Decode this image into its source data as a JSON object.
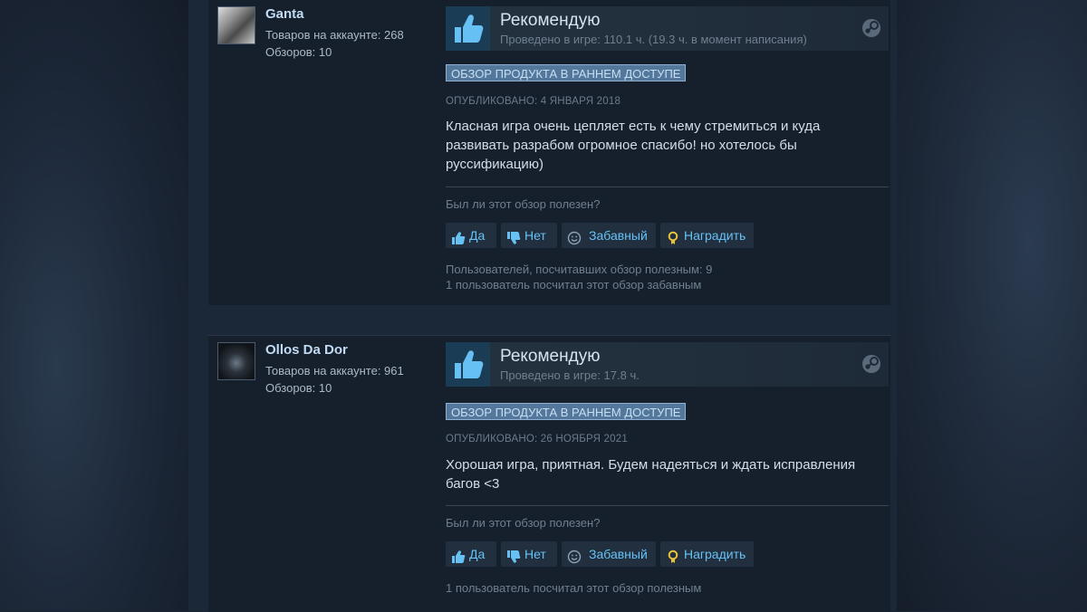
{
  "colors": {
    "accent": "#67c1f5",
    "early_access_bg": "#54779c",
    "panel_bg": "#16202d",
    "page_bg": "#1b2838"
  },
  "icons": {
    "recommend": "thumbs-up-icon",
    "platform": "steam-icon",
    "yes": "thumbs-up-icon",
    "no": "thumbs-down-icon",
    "funny": "smiley-icon",
    "award": "award-icon"
  },
  "reviews": [
    {
      "author": {
        "name": "Ganta",
        "products": "Товаров на аккаунте: 268",
        "reviews": "Обзоров: 10"
      },
      "verdict": "Рекомендую",
      "hours": "Проведено в игре: 110.1 ч. (19.3 ч. в момент написания)",
      "early_access": "ОБЗОР ПРОДУКТА В РАННЕМ ДОСТУПЕ",
      "posted": "ОПУБЛИКОВАНО: 4 ЯНВАРЯ 2018",
      "text": "Класная игра очень цепляет есть к чему стремиться и куда развивать разрабом огромное спасибо! но хотелось бы руссификацию)",
      "helpful_question": "Был ли этот обзор полезен?",
      "buttons": {
        "yes": "Да",
        "no": "Нет",
        "funny": "Забавный",
        "award": "Наградить"
      },
      "footer": [
        "Пользователей, посчитавших обзор полезным: 9",
        "1 пользователь посчитал этот обзор забавным"
      ]
    },
    {
      "author": {
        "name": "Ollos Da Dor",
        "products": "Товаров на аккаунте: 961",
        "reviews": "Обзоров: 10"
      },
      "verdict": "Рекомендую",
      "hours": "Проведено в игре: 17.8 ч.",
      "early_access": "ОБЗОР ПРОДУКТА В РАННЕМ ДОСТУПЕ",
      "posted": "ОПУБЛИКОВАНО: 26 НОЯБРЯ 2021",
      "text": "Хорошая игра, приятная. Будем надеяться и ждать исправления багов <3",
      "helpful_question": "Был ли этот обзор полезен?",
      "buttons": {
        "yes": "Да",
        "no": "Нет",
        "funny": "Забавный",
        "award": "Наградить"
      },
      "footer": [
        "1 пользователь посчитал этот обзор полезным"
      ]
    }
  ]
}
